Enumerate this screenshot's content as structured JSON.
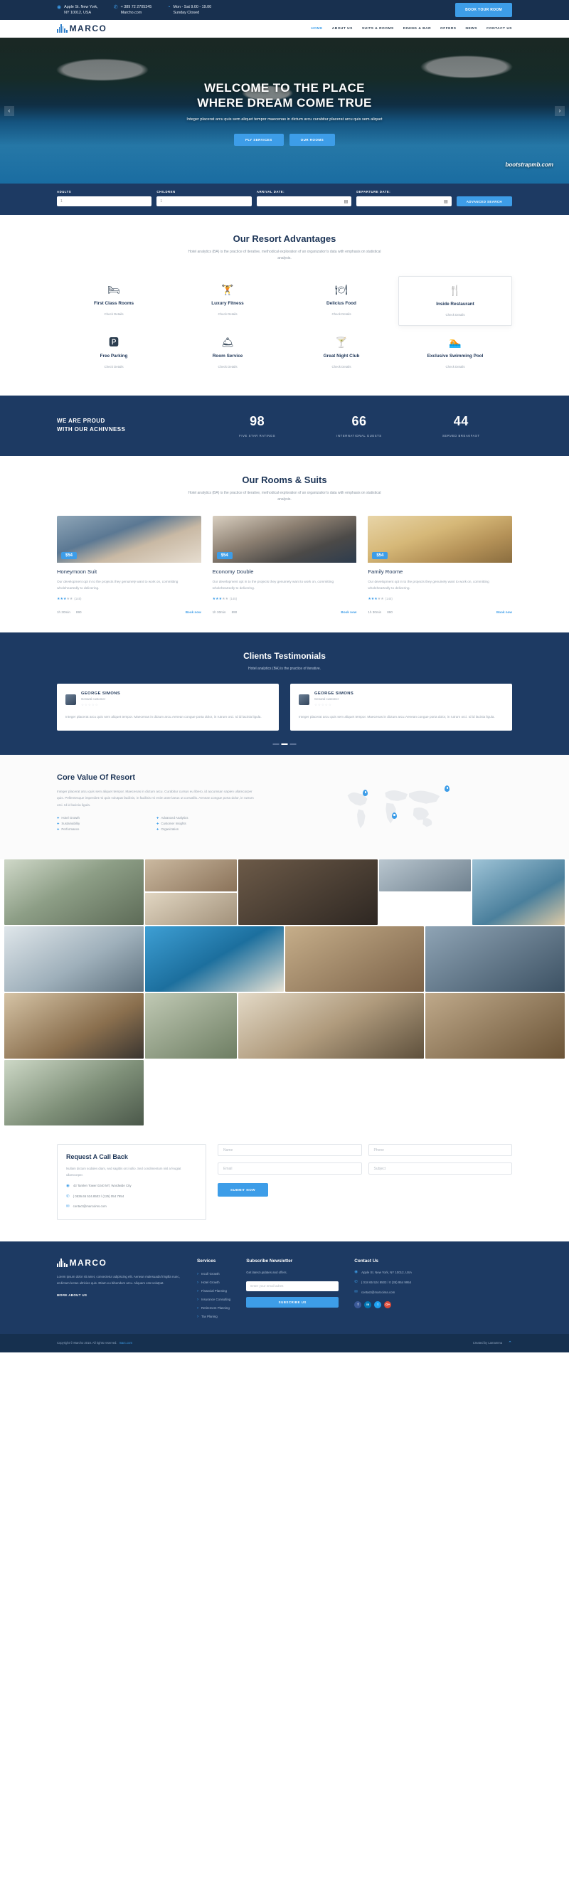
{
  "topbar": {
    "address": [
      "Apple St. New York,",
      "NY 10012, USA"
    ],
    "phone": [
      "+ 389 72 2705345",
      "Marcho.com"
    ],
    "hours": [
      "Mon - Sat 9.00 - 19.00",
      "Sunday Closed"
    ],
    "book_button": "BOOK YOUR ROOM"
  },
  "nav": {
    "logo": "MARCO",
    "links": [
      {
        "label": "HOME",
        "active": true
      },
      {
        "label": "ABOUT US",
        "active": false
      },
      {
        "label": "SUITS & ROOMS",
        "active": false
      },
      {
        "label": "DINING & BAR",
        "active": false
      },
      {
        "label": "OFFERS",
        "active": false
      },
      {
        "label": "NEWS",
        "active": false
      },
      {
        "label": "CONTACT US",
        "active": false
      }
    ]
  },
  "hero": {
    "title_line1": "WELCOME TO THE PLACE",
    "title_line2": "WHERE DREAM COME TRUE",
    "paragraph": "Integer placerat arcu quis sem aliquet tempor maecenas in dictum arcu curabitur placerat arcu quis sem aliquet",
    "btn_primary": "PLY SERVICES",
    "btn_secondary": "OUR ROOMS",
    "prev_arrow": "‹",
    "next_arrow": "›",
    "watermark": "bootstrapmb.com"
  },
  "booking": {
    "fields": [
      {
        "label": "ADULTS",
        "value": "1",
        "icon": ""
      },
      {
        "label": "CHILDREN",
        "value": "1",
        "icon": ""
      },
      {
        "label": "ARRIVAL DATE:",
        "value": "",
        "icon": "📅"
      },
      {
        "label": "DEPARTURE DATE:",
        "value": "",
        "icon": "📅"
      }
    ],
    "search_button": "ADVANCED SEARCH"
  },
  "advantages": {
    "title": "Our Resort Advantages",
    "subtitle": "Hotel analytics (BA) is the practice of iterative, methodical exploration of an organization's data with emphasis on statistical analysis.",
    "link_label": "Check Details",
    "items": [
      {
        "icon": "🛏",
        "title": "First Class Rooms",
        "boxed": false
      },
      {
        "icon": "🏋",
        "title": "Luxury Fitness",
        "boxed": false
      },
      {
        "icon": "🍽",
        "title": "Delicius Food",
        "boxed": false
      },
      {
        "icon": "🍴",
        "title": "Inside Restaurant",
        "boxed": true
      },
      {
        "icon": "🅿",
        "title": "Free Parking",
        "boxed": false
      },
      {
        "icon": "🛎",
        "title": "Room Service",
        "boxed": false
      },
      {
        "icon": "🍸",
        "title": "Great Night Club",
        "boxed": false
      },
      {
        "icon": "🏊",
        "title": "Exclusive Swimming Pool",
        "boxed": false
      }
    ]
  },
  "stats": {
    "heading_line1": "WE ARE PROUD",
    "heading_line2": "WITH OUR ACHIVNESS",
    "items": [
      {
        "value": "98",
        "label": "FIVE STAR RATINGS"
      },
      {
        "value": "66",
        "label": "INTERNATIONAL GUESTS"
      },
      {
        "value": "44",
        "label": "SERVED BREAKFAST"
      }
    ]
  },
  "rooms": {
    "title": "Our Rooms & Suits",
    "subtitle": "Hotel analytics (BA) is the practice of iterative, methodical exploration of an organization's data with emphasis on statistical analysis.",
    "items": [
      {
        "price": "$54",
        "name": "Honeymoon Suit",
        "desc": "Our development opt in to the projects they genuinely want to work on, committing wholeheartedly to delivering.",
        "stars_on": 3,
        "reviews": "(145)",
        "duration": "1h 30min",
        "code": "890",
        "cta": "Book now"
      },
      {
        "price": "$54",
        "name": "Economy Double",
        "desc": "Our development opt in to the projects they genuinely want to work on, committing wholeheartedly to delivering.",
        "stars_on": 3,
        "reviews": "(145)",
        "duration": "1h 30min",
        "code": "890",
        "cta": "Book now"
      },
      {
        "price": "$54",
        "name": "Family Roome",
        "desc": "Our development opt in to the projects they genuinely want to work on, committing wholeheartedly to delivering.",
        "stars_on": 3,
        "reviews": "(145)",
        "duration": "1h 30min",
        "code": "890",
        "cta": "Book now"
      }
    ]
  },
  "testimonials": {
    "title": "Clients Testimonials",
    "subtitle": "Hotel analytics (BA) is the practice of iterative.",
    "items": [
      {
        "name": "GEORGE SIMONS",
        "role": "Genaral customer",
        "stars": "☆☆☆☆☆",
        "text": "Integer placerat arcu quis sem aliquet tempor. Maecenas in dictum arcu.Aenean congue porta dolor, in rutrum orci. Id id lacinia ligula."
      },
      {
        "name": "GEORGE SIMONS",
        "role": "Genaral customer",
        "stars": "☆☆☆☆☆",
        "text": "Integer placerat arcu quis sem aliquet tempor. Maecenas in dictum arcu.Aenean congue porta dolor, in rutrum orci. Id id lacinia ligula."
      }
    ]
  },
  "core": {
    "title": "Core Value Of Resort",
    "paragraph": "Integer placerat arcu quis sem aliquet tempor. Maecenas in dictum arcu. Curabitur cursus eu libero, id accumsan sapien ullamcorper quis. Pellentesque imperdiet mi quis volutpat facilisis, in facilisis mi enim ante laeus ut convallis. Aenean congue porta dolor, in rutrum orci. Id id lacinia ligula.",
    "tags": [
      "Hotel Growth",
      "Advanced Analytics",
      "Sustainability",
      "Customer Insights",
      "Performance",
      "Organization"
    ]
  },
  "callback": {
    "title": "Request A Call Back",
    "paragraph": "Nullam dictum sodales diam, sed sagittis orci iullio. Sed condimentum nisl a feugiat ullamcorper.",
    "address": "43 Tamlen Tower 0240 MT, Wordwide City",
    "phone": "( 0536.65 524.8503 / (125) 054 7954",
    "email": "contact@marcoims.com",
    "form": {
      "name_placeholder": "Name",
      "phone_placeholder": "Phone",
      "email_placeholder": "Email",
      "subject_placeholder": "Subject",
      "submit": "SUBMIT NOW"
    }
  },
  "footer": {
    "logo": "MARCO",
    "about": "Lorem ipsum dolor sit amet, consectetur adipiscing elit. Aenean malesuada fringilla nunc, at dictum lectus ultricies quis. Etiam eu bibendum arcu. Aliquam erat volutpat.",
    "more_link": "MORE ABOUT US",
    "services": {
      "title": "Services",
      "items": [
        "Incoll Growth",
        "Hotel Growth",
        "Financial Planning",
        "Insurance Consulting",
        "Retirement Planning",
        "Tax Planing"
      ]
    },
    "newsletter": {
      "title": "Subscribe Newsletter",
      "desc": "Get latest updates and offers.",
      "placeholder": "Enter your email adres",
      "button": "SUBSCRIBE US"
    },
    "contact": {
      "title": "Contact Us",
      "address": "Apple St. New York, NY 10012, USA",
      "phone": "( 018 65 524 8503 / 0 (35) 954 9954",
      "email": "contact@marcoima.com",
      "socials": [
        "f",
        "in",
        "t",
        "G+"
      ]
    }
  },
  "copyright": {
    "left": "Copyright © Marcho 2018. All rights reserved.",
    "left_link": "marc.com",
    "right": "Created by Lamamma",
    "up_icon": "⌃"
  }
}
